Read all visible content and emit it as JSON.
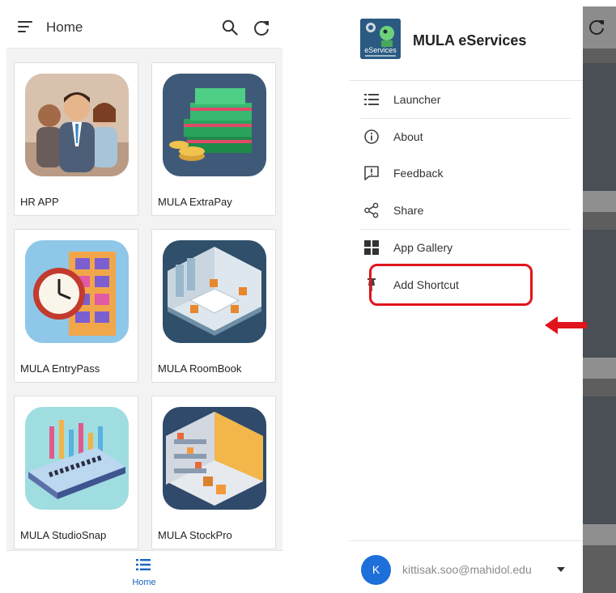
{
  "home_screen": {
    "title": "Home",
    "apps": [
      {
        "label": "HR APP",
        "icon": "people-illustration"
      },
      {
        "label": "MULA ExtraPay",
        "icon": "money-stack-illustration"
      },
      {
        "label": "MULA EntryPass",
        "icon": "clock-building-illustration"
      },
      {
        "label": "MULA RoomBook",
        "icon": "meeting-room-illustration"
      },
      {
        "label": "MULA StudioSnap",
        "icon": "mixing-console-illustration"
      },
      {
        "label": "MULA StockPro",
        "icon": "warehouse-illustration"
      }
    ],
    "bottom_nav": {
      "home_label": "Home"
    }
  },
  "drawer": {
    "app_name": "MULA eServices",
    "logo_text": "eServices",
    "menu": [
      {
        "label": "Launcher",
        "icon": "list-icon"
      },
      {
        "label": "About",
        "icon": "info-icon"
      },
      {
        "label": "Feedback",
        "icon": "feedback-icon"
      },
      {
        "label": "Share",
        "icon": "share-icon"
      },
      {
        "label": "App Gallery",
        "icon": "grid-icon"
      },
      {
        "label": "Add Shortcut",
        "icon": "pin-icon"
      }
    ],
    "user": {
      "initial": "K",
      "email": "kittisak.soo@mahidol.edu"
    }
  },
  "colors": {
    "accent": "#1565c0",
    "highlight": "#e0141b",
    "avatar": "#1e6fd9"
  }
}
